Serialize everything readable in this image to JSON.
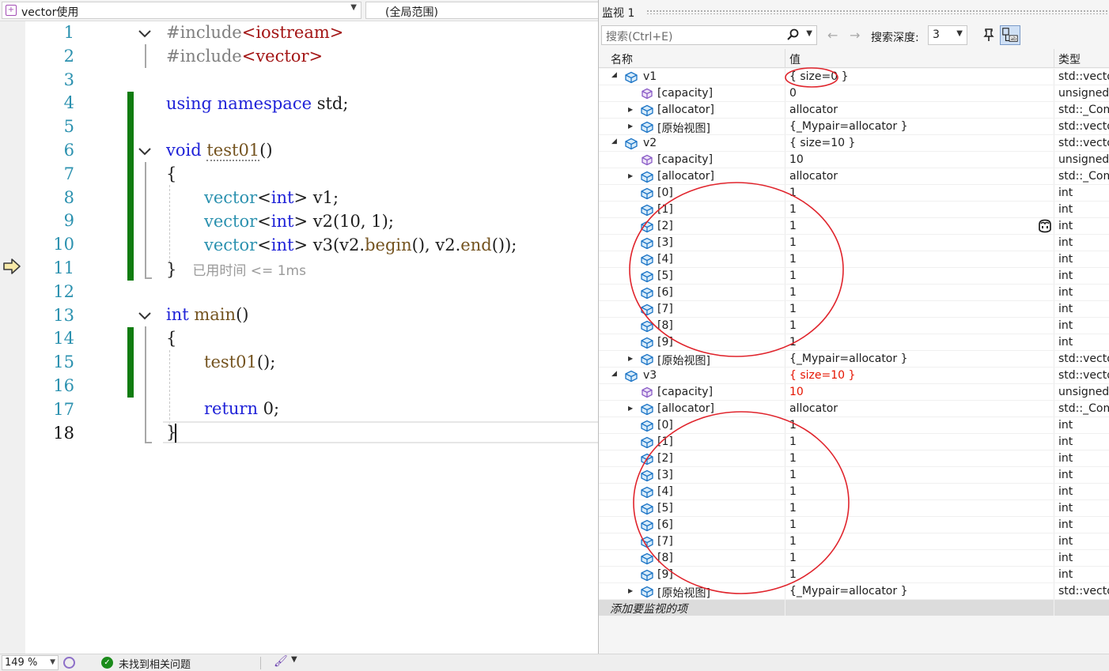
{
  "navbar": {
    "file_scope": "vector使用",
    "scope": "(全局范围)"
  },
  "editor": {
    "line_numbers": [
      "1",
      "2",
      "3",
      "4",
      "5",
      "6",
      "7",
      "8",
      "9",
      "10",
      "11",
      "12",
      "13",
      "14",
      "15",
      "16",
      "17",
      "18"
    ],
    "elapsed": "已用时间 <= 1ms",
    "code": {
      "l1_kw": "#include",
      "l1_str": "<iostream>",
      "l2_kw": "#include",
      "l2_str": "<vector>",
      "l4_using": "using",
      "l4_namespace": "namespace",
      "l4_rest": " std;",
      "l6_void": "void",
      "l6_fn": "test01",
      "l6_rest": "()",
      "l7": "{",
      "l8_ty": "vector",
      "l8_t1": "<",
      "l8_int": "int",
      "l8_t2": ">",
      "l8_rest": " v1;",
      "l9_ty": "vector",
      "l9_t1": "<",
      "l9_int": "int",
      "l9_t2": ">",
      "l9_rest": " v2(10, 1);",
      "l10_ty": "vector",
      "l10_t1": "<",
      "l10_int": "int",
      "l10_t2": ">",
      "l10_a": " v3(v2.",
      "l10_begin": "begin",
      "l10_b": "(), v2.",
      "l10_end": "end",
      "l10_c": "());",
      "l11": "}",
      "l13_int": "int",
      "l13_fn": "main",
      "l13_rest": "()",
      "l14": "{",
      "l15_fn": "test01",
      "l15_rest": "();",
      "l17_kw": "return",
      "l17_rest": " 0;",
      "l18": "}"
    }
  },
  "statusbar": {
    "zoom": "149 %",
    "issues": "未找到相关问题"
  },
  "watch": {
    "title": "监视 1",
    "search_placeholder": "搜索(Ctrl+E)",
    "depth_label": "搜索深度:",
    "depth_value": "3",
    "columns": {
      "name": "名称",
      "value": "值",
      "type": "类型"
    },
    "add_item": "添加要监视的项",
    "rows": [
      {
        "level": 0,
        "expander": "open",
        "icon": "object",
        "name": "v1",
        "value": "{ size=0 }",
        "type": "std::vector",
        "changed": false
      },
      {
        "level": 1,
        "expander": "none",
        "icon": "field",
        "name": "[capacity]",
        "value": "0",
        "type": "unsigned ...",
        "changed": false
      },
      {
        "level": 1,
        "expander": "closed",
        "icon": "object",
        "name": "[allocator]",
        "value": "allocator",
        "type": "std::_Comp",
        "changed": false
      },
      {
        "level": 1,
        "expander": "closed",
        "icon": "object",
        "name": "[原始视图]",
        "value": "{_Mypair=allocator }",
        "type": "std::vector",
        "changed": false
      },
      {
        "level": 0,
        "expander": "open",
        "icon": "object",
        "name": "v2",
        "value": "{ size=10 }",
        "type": "std::vector",
        "changed": false
      },
      {
        "level": 1,
        "expander": "none",
        "icon": "field",
        "name": "[capacity]",
        "value": "10",
        "type": "unsigned ...",
        "changed": false
      },
      {
        "level": 1,
        "expander": "closed",
        "icon": "object",
        "name": "[allocator]",
        "value": "allocator",
        "type": "std::_Comp",
        "changed": false
      },
      {
        "level": 1,
        "expander": "none",
        "icon": "object",
        "name": "[0]",
        "value": "1",
        "type": "int",
        "changed": false
      },
      {
        "level": 1,
        "expander": "none",
        "icon": "object",
        "name": "[1]",
        "value": "1",
        "type": "int",
        "changed": false
      },
      {
        "level": 1,
        "expander": "none",
        "icon": "object",
        "name": "[2]",
        "value": "1",
        "type": "int",
        "changed": false
      },
      {
        "level": 1,
        "expander": "none",
        "icon": "object",
        "name": "[3]",
        "value": "1",
        "type": "int",
        "changed": false
      },
      {
        "level": 1,
        "expander": "none",
        "icon": "object",
        "name": "[4]",
        "value": "1",
        "type": "int",
        "changed": false
      },
      {
        "level": 1,
        "expander": "none",
        "icon": "object",
        "name": "[5]",
        "value": "1",
        "type": "int",
        "changed": false
      },
      {
        "level": 1,
        "expander": "none",
        "icon": "object",
        "name": "[6]",
        "value": "1",
        "type": "int",
        "changed": false
      },
      {
        "level": 1,
        "expander": "none",
        "icon": "object",
        "name": "[7]",
        "value": "1",
        "type": "int",
        "changed": false
      },
      {
        "level": 1,
        "expander": "none",
        "icon": "object",
        "name": "[8]",
        "value": "1",
        "type": "int",
        "changed": false
      },
      {
        "level": 1,
        "expander": "none",
        "icon": "object",
        "name": "[9]",
        "value": "1",
        "type": "int",
        "changed": false
      },
      {
        "level": 1,
        "expander": "closed",
        "icon": "object",
        "name": "[原始视图]",
        "value": "{_Mypair=allocator }",
        "type": "std::vector",
        "changed": false
      },
      {
        "level": 0,
        "expander": "open",
        "icon": "object",
        "name": "v3",
        "value": "{ size=10 }",
        "type": "std::vector",
        "changed": true
      },
      {
        "level": 1,
        "expander": "none",
        "icon": "field",
        "name": "[capacity]",
        "value": "10",
        "type": "unsigned ...",
        "changed": true
      },
      {
        "level": 1,
        "expander": "closed",
        "icon": "object",
        "name": "[allocator]",
        "value": "allocator",
        "type": "std::_Comp",
        "changed": false
      },
      {
        "level": 1,
        "expander": "none",
        "icon": "object",
        "name": "[0]",
        "value": "1",
        "type": "int",
        "changed": false
      },
      {
        "level": 1,
        "expander": "none",
        "icon": "object",
        "name": "[1]",
        "value": "1",
        "type": "int",
        "changed": false
      },
      {
        "level": 1,
        "expander": "none",
        "icon": "object",
        "name": "[2]",
        "value": "1",
        "type": "int",
        "changed": false
      },
      {
        "level": 1,
        "expander": "none",
        "icon": "object",
        "name": "[3]",
        "value": "1",
        "type": "int",
        "changed": false
      },
      {
        "level": 1,
        "expander": "none",
        "icon": "object",
        "name": "[4]",
        "value": "1",
        "type": "int",
        "changed": false
      },
      {
        "level": 1,
        "expander": "none",
        "icon": "object",
        "name": "[5]",
        "value": "1",
        "type": "int",
        "changed": false
      },
      {
        "level": 1,
        "expander": "none",
        "icon": "object",
        "name": "[6]",
        "value": "1",
        "type": "int",
        "changed": false
      },
      {
        "level": 1,
        "expander": "none",
        "icon": "object",
        "name": "[7]",
        "value": "1",
        "type": "int",
        "changed": false
      },
      {
        "level": 1,
        "expander": "none",
        "icon": "object",
        "name": "[8]",
        "value": "1",
        "type": "int",
        "changed": false
      },
      {
        "level": 1,
        "expander": "none",
        "icon": "object",
        "name": "[9]",
        "value": "1",
        "type": "int",
        "changed": false
      },
      {
        "level": 1,
        "expander": "closed",
        "icon": "object",
        "name": "[原始视图]",
        "value": "{_Mypair=allocator }",
        "type": "std::vector",
        "changed": false
      }
    ]
  },
  "colors": {
    "keyword": "#1f22d8",
    "type": "#2b91af",
    "string": "#a31515",
    "changed_value": "#e51400",
    "change_bar": "#107c10",
    "annotation": "#e0242c"
  }
}
